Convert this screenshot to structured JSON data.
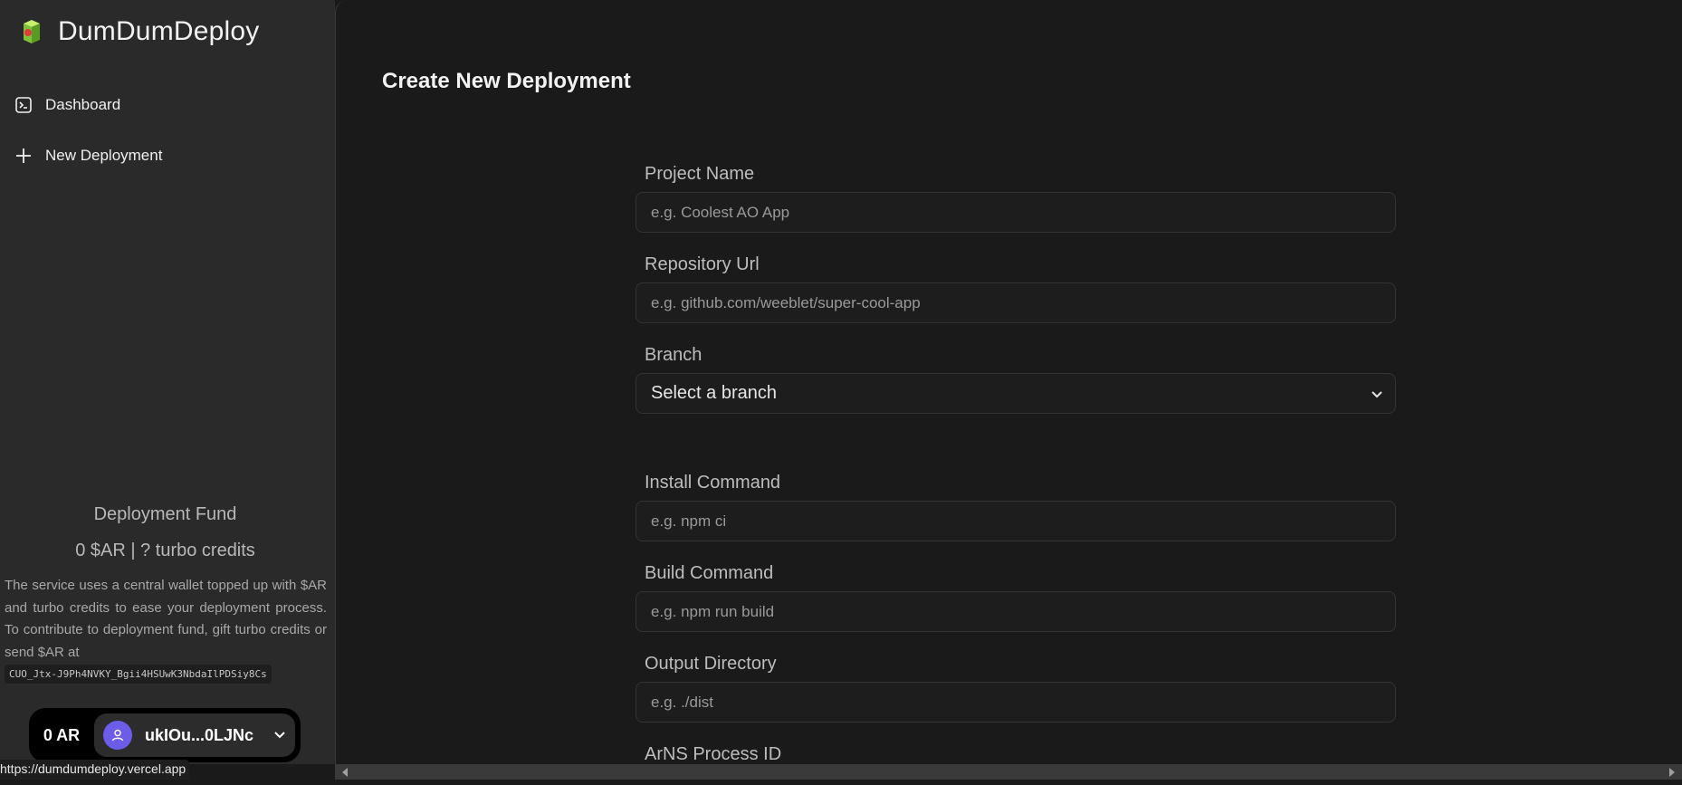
{
  "brand": {
    "name": "DumDumDeploy",
    "icon": "logo-icon"
  },
  "sidebar": {
    "items": [
      {
        "label": "Dashboard",
        "icon": "terminal-icon"
      },
      {
        "label": "New Deployment",
        "icon": "plus-icon"
      }
    ],
    "fund": {
      "title": "Deployment Fund",
      "balance": "0 $AR | ? turbo credits",
      "description": "The service uses a central wallet topped up with $AR and turbo credits to ease your deployment process. To contribute to deployment fund, gift turbo credits or send $AR at",
      "address": "CUO_Jtx-J9Ph4NVKY_Bgii4HSUwK3NbdaIlPDSiy8Cs"
    },
    "wallet": {
      "balance": "0 AR",
      "account": "ukIOu...0LJNc"
    }
  },
  "main": {
    "title": "Create New Deployment",
    "fields": {
      "project_name": {
        "label": "Project Name",
        "placeholder": "e.g. Coolest AO App"
      },
      "repository_url": {
        "label": "Repository Url",
        "placeholder": "e.g. github.com/weeblet/super-cool-app"
      },
      "branch": {
        "label": "Branch",
        "value": "Select a branch"
      },
      "install_command": {
        "label": "Install Command",
        "placeholder": "e.g. npm ci"
      },
      "build_command": {
        "label": "Build Command",
        "placeholder": "e.g. npm run build"
      },
      "output_directory": {
        "label": "Output Directory",
        "placeholder": "e.g. ./dist"
      },
      "arns_process_id": {
        "label": "ArNS Process ID"
      }
    }
  },
  "status_bar": {
    "url": "https://dumdumdeploy.vercel.app"
  },
  "colors": {
    "avatar": "#6b5de8",
    "background": "#1a1a1a",
    "sidebar": "#2a2a2a"
  }
}
